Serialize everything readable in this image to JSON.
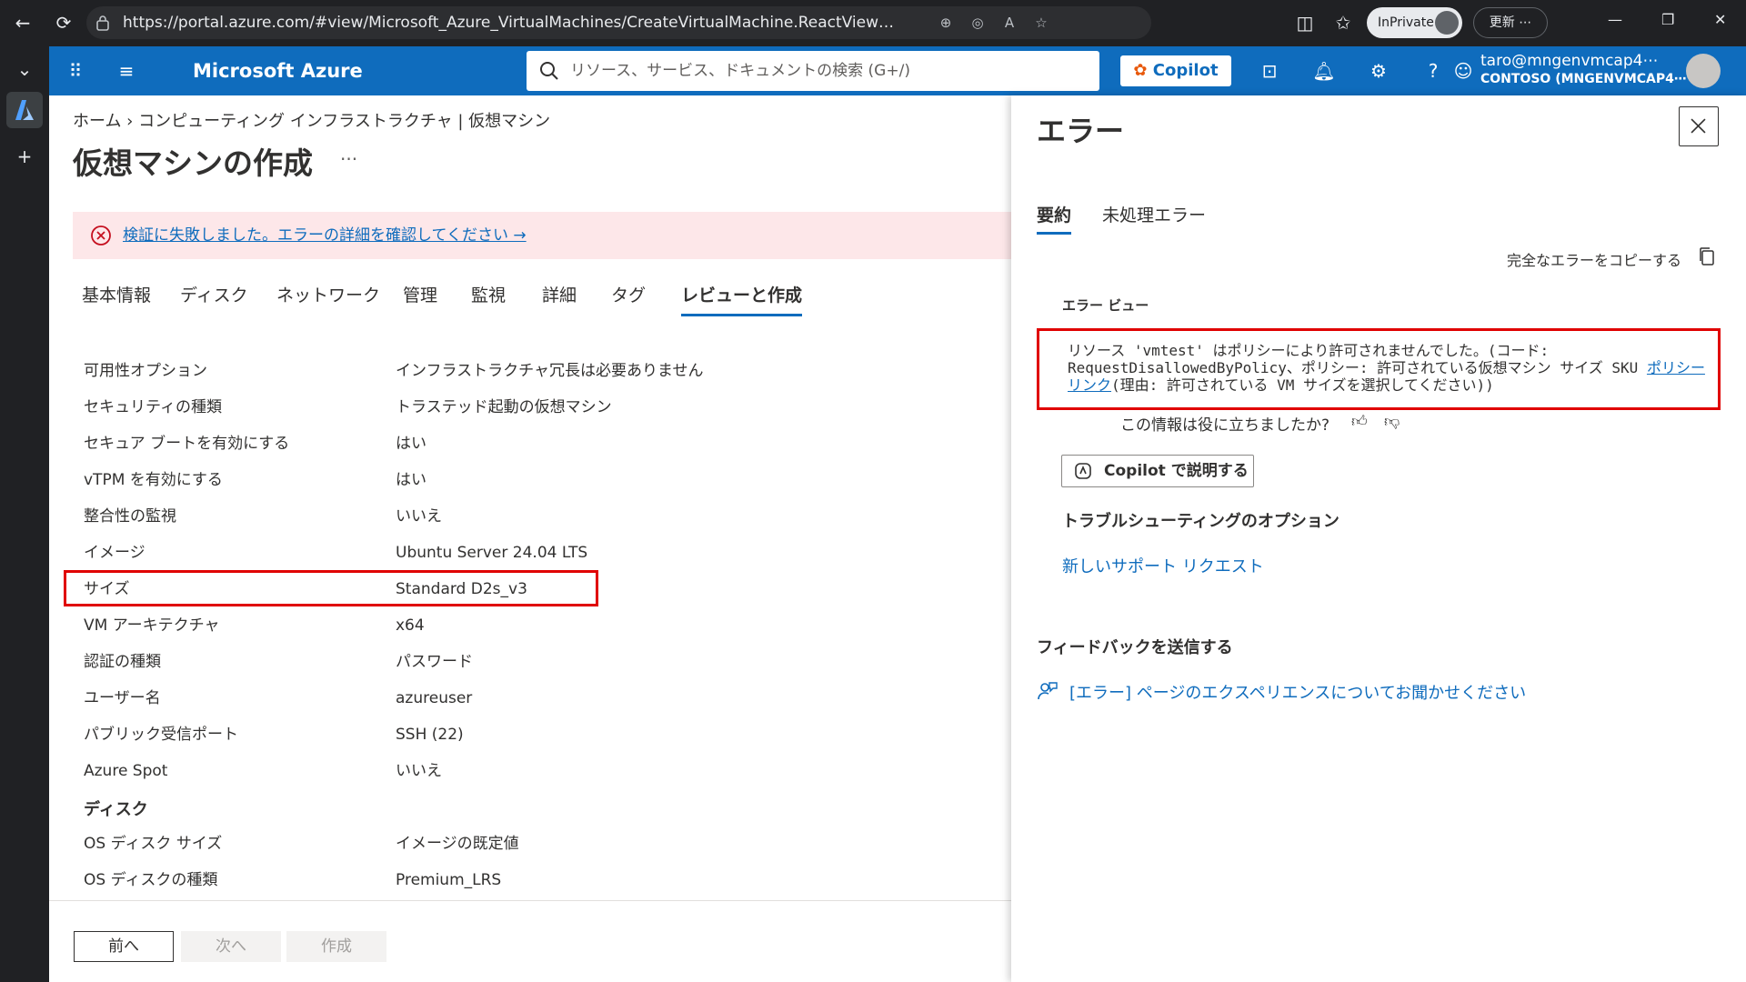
{
  "browser": {
    "url": "https://portal.azure.com/#view/Microsoft_Azure_VirtualMachines/CreateVirtualMachine.ReactView/createUiDef~/%7B\"isFullCreate\"%3Atrue%7...",
    "inprivate_label": "InPrivate",
    "update_label": "更新 ⋯"
  },
  "header": {
    "brand": "Microsoft Azure",
    "search_placeholder": "リソース、サービス、ドキュメントの検索 (G+/)",
    "copilot_label": "Copilot",
    "account_email": "taro@mngenvmcap4⋯",
    "account_tenant": "CONTOSO (MNGENVMCAP4⋯"
  },
  "main": {
    "breadcrumb": "ホーム  ›  コンピューティング インフラストラクチャ | 仮想マシン",
    "title": "仮想マシンの作成",
    "more": "···",
    "error_banner": "検証に失敗しました。エラーの詳細を確認してください →",
    "tabs": [
      "基本情報",
      "ディスク",
      "ネットワーク",
      "管理",
      "監視",
      "詳細",
      "タグ",
      "レビューと作成"
    ],
    "rows": [
      {
        "k": "可用性オプション",
        "v": "インフラストラクチャ冗長は必要ありません"
      },
      {
        "k": "セキュリティの種類",
        "v": "トラステッド起動の仮想マシン"
      },
      {
        "k": "セキュア ブートを有効にする",
        "v": "はい"
      },
      {
        "k": "vTPM を有効にする",
        "v": "はい"
      },
      {
        "k": "整合性の監視",
        "v": "いいえ"
      },
      {
        "k": "イメージ",
        "v": "Ubuntu Server 24.04 LTS"
      },
      {
        "k": "サイズ",
        "v": "Standard D2s_v3"
      },
      {
        "k": "VM アーキテクチャ",
        "v": "x64"
      },
      {
        "k": "認証の種類",
        "v": "パスワード"
      },
      {
        "k": "ユーザー名",
        "v": "azureuser"
      },
      {
        "k": "パブリック受信ポート",
        "v": "SSH (22)"
      },
      {
        "k": "Azure Spot",
        "v": "いいえ"
      }
    ],
    "disk_section": "ディスク",
    "disk_rows": [
      {
        "k": "OS ディスク サイズ",
        "v": "イメージの既定値"
      },
      {
        "k": "OS ディスクの種類",
        "v": "Premium_LRS"
      }
    ],
    "footer": {
      "prev": "前へ",
      "next": "次へ",
      "create": "作成"
    }
  },
  "panel": {
    "title": "エラー",
    "tabs": [
      "要約",
      "未処理エラー"
    ],
    "copy_all": "完全なエラーをコピーする",
    "error_view_label": "エラー ビュー",
    "error_message_pre": "リソース 'vmtest' はポリシーにより許可されませんでした。(コード: RequestDisallowedByPolicy、ポリシー: 許可されている仮想マシン サイズ SKU ",
    "error_link": "ポリシー リンク",
    "error_message_post": "(理由: 許可されている VM サイズを選択してください))",
    "helpful": "この情報は役に立ちましたか?",
    "copilot_explain": "Copilot で説明する",
    "troubleshoot_heading": "トラブルシューティングのオプション",
    "support_request": "新しいサポート リクエスト",
    "feedback_heading": "フィードバックを送信する",
    "feedback_link": "[エラー] ページのエクスペリエンスについてお聞かせください"
  },
  "colors": {
    "accent": "#0f6cbd",
    "error": "#e00000",
    "error_bg": "#fde7e9"
  }
}
